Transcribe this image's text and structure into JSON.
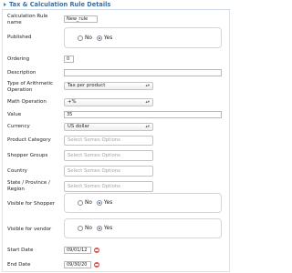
{
  "header": {
    "title": "Tax & Calculation Rule Details"
  },
  "form": {
    "name_label": "Calculation Rule name",
    "name_value": "New_rule",
    "published_label": "Published",
    "published": {
      "no_label": "No",
      "yes_label": "Yes",
      "selected": "Yes"
    },
    "ordering_label": "Ordering",
    "ordering_value": "0",
    "description_label": "Description",
    "description_value": "",
    "type_label": "Type of Arithmetic Operation",
    "type_value": "Tax per product",
    "math_label": "Math Operation",
    "math_value": "+%",
    "value_label": "Value",
    "value_value": "35",
    "currency_label": "Currency",
    "currency_value": "US dollar",
    "category_label": "Product Category",
    "category_placeholder": "Select Somes Options",
    "shopper_label": "Shopper Groups",
    "shopper_placeholder": "Select Somes Options",
    "country_label": "Country",
    "country_placeholder": "Select Somes Options",
    "state_label": "State / Province / Region",
    "state_placeholder": "Select Somes Options",
    "visible_shopper_label": "Visible for Shopper",
    "visible_shopper": {
      "no_label": "No",
      "yes_label": "Yes",
      "selected": "Yes"
    },
    "visible_vendor_label": "Visible for vendor",
    "visible_vendor": {
      "no_label": "No",
      "yes_label": "Yes",
      "selected": "Yes"
    },
    "start_label": "Start Date",
    "start_value": "09/01/12",
    "end_label": "End Date",
    "end_value": "09/30/20"
  },
  "icons": {
    "header": "chevron-right-icon",
    "select_arrow": "chevron-up-down-icon",
    "calendar": "calendar-icon"
  },
  "colors": {
    "header_title": "#3a6ea5",
    "calendar_button": "#d9534f",
    "radio_selected": "#2d6bb5"
  }
}
